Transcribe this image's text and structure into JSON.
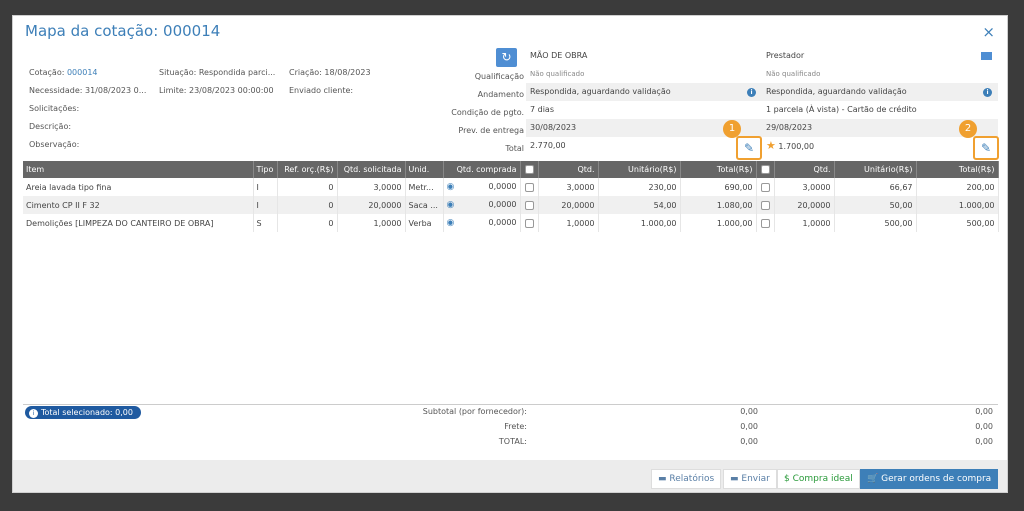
{
  "modal": {
    "title": "Mapa da cotação: 000014",
    "close": "×"
  },
  "info": {
    "cotacao_label": "Cotação: ",
    "cotacao_value": "000014",
    "situacao": "Situação: Respondida parci...",
    "criacao": "Criação: 18/08/2023",
    "necessidade": "Necessidade: 31/08/2023 0...",
    "limite": "Limite: 23/08/2023 00:00:00",
    "enviado": "Enviado cliente:",
    "solicitacoes": "Solicitações:",
    "descricao": "Descrição:",
    "observacao": "Observação:"
  },
  "labels": {
    "qualificacao": "Qualificação",
    "andamento": "Andamento",
    "condicao": "Condição de pgto.",
    "prev": "Prev. de entrega",
    "total": "Total"
  },
  "suppliers": [
    {
      "name": "MÃO DE OBRA",
      "qualificacao": "Não qualificado",
      "andamento": "Respondida, aguardando validação",
      "condicao": "7 dias",
      "prev": "30/08/2023",
      "total": "2.770,00",
      "badge": "1"
    },
    {
      "name": "Prestador",
      "qualificacao": "Não qualificado",
      "andamento": "Respondida, aguardando validação",
      "condicao": "1 parcela (À vista) - Cartão de crédito",
      "prev": "29/08/2023",
      "total": "1.700,00",
      "badge": "2"
    }
  ],
  "table": {
    "headers": [
      "Item",
      "Tipo",
      "Ref. orç.(R$)",
      "Qtd. solicitada",
      "Unid.",
      "Qtd. comprada",
      "Qtd.",
      "Unitário(R$)",
      "Total(R$)",
      "Qtd.",
      "Unitário(R$)",
      "Total(R$)"
    ],
    "rows": [
      {
        "item": "Areia lavada tipo fina",
        "tipo": "I",
        "ref": "0",
        "qtdsol": "3,0000",
        "unid": "Metr...",
        "qtdcomp": "0,0000",
        "s1q": "3,0000",
        "s1u": "230,00",
        "s1t": "690,00",
        "s2q": "3,0000",
        "s2u": "66,67",
        "s2t": "200,00"
      },
      {
        "item": "Cimento CP II F 32",
        "tipo": "I",
        "ref": "0",
        "qtdsol": "20,0000",
        "unid": "Saca ...",
        "qtdcomp": "0,0000",
        "s1q": "20,0000",
        "s1u": "54,00",
        "s1t": "1.080,00",
        "s2q": "20,0000",
        "s2u": "50,00",
        "s2t": "1.000,00"
      },
      {
        "item": "Demolições [LIMPEZA DO CANTEIRO DE OBRA]",
        "tipo": "S",
        "ref": "0",
        "qtdsol": "1,0000",
        "unid": "Verba",
        "qtdcomp": "0,0000",
        "s1q": "1,0000",
        "s1u": "1.000,00",
        "s1t": "1.000,00",
        "s2q": "1,0000",
        "s2u": "500,00",
        "s2t": "500,00"
      }
    ]
  },
  "summary": {
    "total_sel": "Total selecionado:  0,00",
    "subtotal_label": "Subtotal (por fornecedor):",
    "frete_label": "Frete:",
    "total_label": "TOTAL:",
    "s1": [
      "0,00",
      "0,00",
      "0,00"
    ],
    "s2": [
      "0,00",
      "0,00",
      "0,00"
    ]
  },
  "footer": {
    "relatorios": "Relatórios",
    "enviar": "Enviar",
    "compra_ideal": "Compra ideal",
    "gerar": "Gerar ordens de compra"
  }
}
